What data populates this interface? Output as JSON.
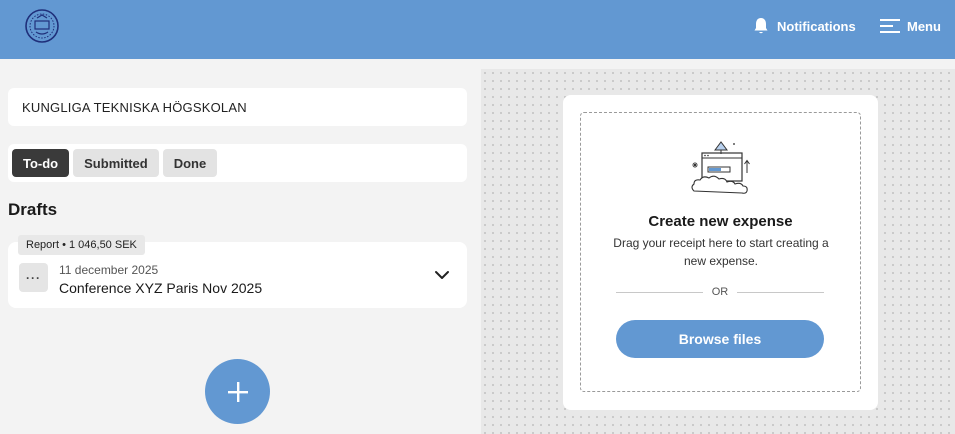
{
  "header": {
    "logo_alt": "KTH",
    "notifications_label": "Notifications",
    "menu_label": "Menu"
  },
  "organization": {
    "name": "KUNGLIGA TEKNISKA HÖGSKOLAN"
  },
  "tabs": [
    {
      "label": "To-do",
      "active": true
    },
    {
      "label": "Submitted",
      "active": false
    },
    {
      "label": "Done",
      "active": false
    }
  ],
  "drafts": {
    "title": "Drafts",
    "items": [
      {
        "badge": "Report • 1 046,50 SEK",
        "date": "11 december 2025",
        "title": "Conference XYZ Paris Nov 2025",
        "more_label": "···"
      }
    ]
  },
  "upload": {
    "title": "Create new expense",
    "description": "Drag your receipt here to start creating a new expense.",
    "or_label": "OR",
    "browse_label": "Browse files"
  },
  "colors": {
    "primary": "#6298d2",
    "active_tab": "#3a3a3a",
    "background": "#f3f3f3"
  },
  "icons": {
    "notifications": "bell-icon",
    "menu": "hamburger-icon",
    "add": "plus-icon",
    "expand": "chevron-down-icon"
  }
}
